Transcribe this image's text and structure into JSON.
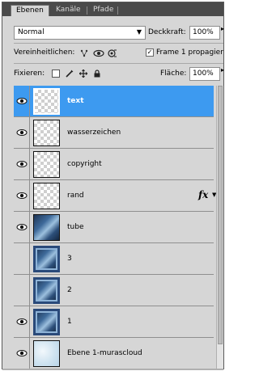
{
  "tabs": [
    {
      "label": "Ebenen",
      "active": true
    },
    {
      "label": "Kanäle",
      "active": false
    },
    {
      "label": "Pfade",
      "active": false
    }
  ],
  "blend_mode": {
    "value": "Normal"
  },
  "opacity": {
    "label": "Deckkraft:",
    "value": "100%"
  },
  "unify": {
    "label": "Vereinheitlichen:",
    "icons": [
      "unify-position-icon",
      "unify-visibility-icon",
      "unify-style-icon"
    ],
    "frame_propagate": {
      "label": "Frame 1 propagier",
      "checked": true
    }
  },
  "lock": {
    "label": "Fixieren:",
    "icons": [
      "lock-transparent-icon",
      "lock-image-icon",
      "lock-position-icon",
      "lock-all-icon"
    ]
  },
  "fill": {
    "label": "Fläche:",
    "value": "100%"
  },
  "layers": [
    {
      "name": "text",
      "visible": true,
      "selected": true,
      "thumb": "transparent"
    },
    {
      "name": "wasserzeichen",
      "visible": true,
      "selected": false,
      "thumb": "transparent"
    },
    {
      "name": "copyright",
      "visible": true,
      "selected": false,
      "thumb": "transparent"
    },
    {
      "name": "rand",
      "visible": true,
      "selected": false,
      "thumb": "transparent",
      "fx": "fx"
    },
    {
      "name": "tube",
      "visible": true,
      "selected": false,
      "thumb": "photo"
    },
    {
      "name": "3",
      "visible": false,
      "selected": false,
      "thumb": "framed"
    },
    {
      "name": "2",
      "visible": false,
      "selected": false,
      "thumb": "framed"
    },
    {
      "name": "1",
      "visible": true,
      "selected": false,
      "thumb": "framed"
    },
    {
      "name": "Ebene 1-murascloud",
      "visible": true,
      "selected": false,
      "thumb": "cloud"
    }
  ],
  "colors": {
    "selection": "#3d9af0",
    "panel": "#d6d6d6",
    "tabbar": "#4a4a4a"
  }
}
